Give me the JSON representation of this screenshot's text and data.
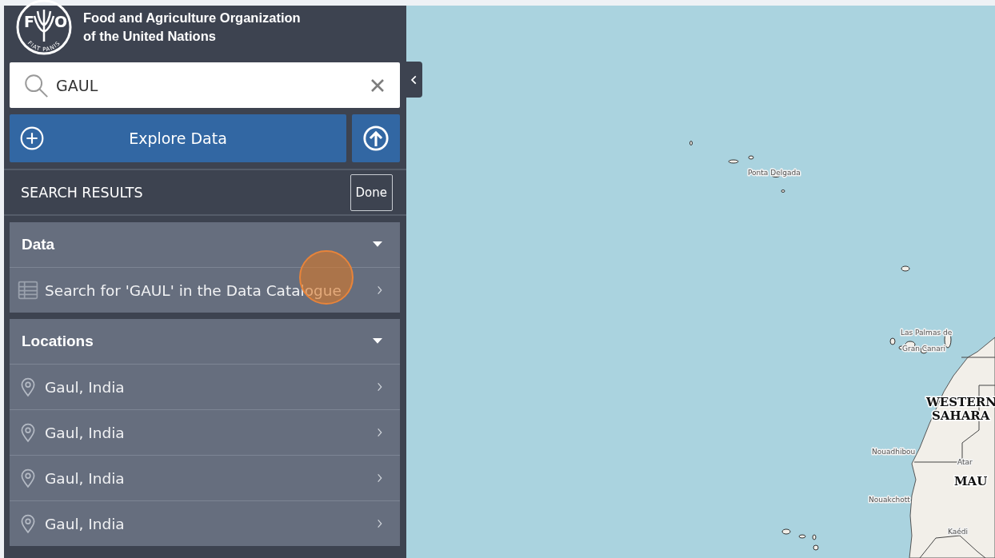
{
  "header": {
    "logo": {
      "letters": [
        "F",
        "O"
      ],
      "motto": "FIAT PANIS"
    },
    "title_lines": [
      "Food and Agriculture Organization",
      "of the United Nations"
    ]
  },
  "search": {
    "value": "GAUL"
  },
  "explore_button": {
    "label": "Explore Data"
  },
  "results_bar": {
    "title": "SEARCH RESULTS",
    "done_label": "Done"
  },
  "sections": [
    {
      "title": "Data",
      "expanded": true,
      "items": [
        {
          "kind": "catalogue",
          "label": "Search for 'GAUL' in the Data Catalogue"
        }
      ]
    },
    {
      "title": "Locations",
      "expanded": true,
      "items": [
        {
          "kind": "location",
          "label": "Gaul, India"
        },
        {
          "kind": "location",
          "label": "Gaul, India"
        },
        {
          "kind": "location",
          "label": "Gaul, India"
        },
        {
          "kind": "location",
          "label": "Gaul, India"
        }
      ]
    }
  ],
  "map": {
    "labels": [
      {
        "kind": "city",
        "text": "Ponta Delgada"
      },
      {
        "kind": "city",
        "text": "Las Palmas de"
      },
      {
        "kind": "city",
        "text": "Gran Canari"
      },
      {
        "kind": "country",
        "text": "WESTERN"
      },
      {
        "kind": "country",
        "text": "SAHARA"
      },
      {
        "kind": "city",
        "text": "Nouadhibou"
      },
      {
        "kind": "city",
        "text": "Atar"
      },
      {
        "kind": "country",
        "text": "MAU"
      },
      {
        "kind": "city",
        "text": "Nouakchott"
      },
      {
        "kind": "city",
        "text": "Kaédi"
      }
    ]
  }
}
